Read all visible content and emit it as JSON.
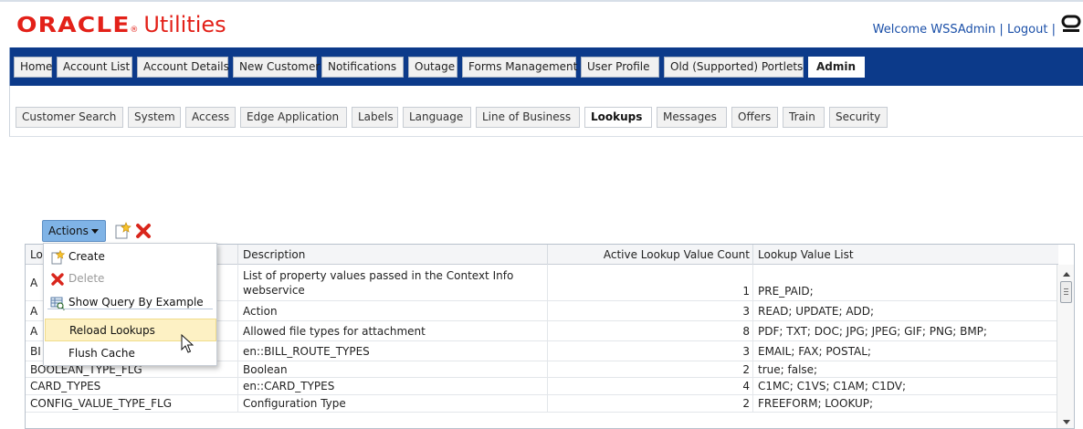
{
  "brand": {
    "oracle": "ORACLE",
    "registered": "®",
    "product": "Utilities"
  },
  "user": {
    "welcome": "Welcome WSSAdmin",
    "separator": "|",
    "logout": "Logout"
  },
  "main_tabs": [
    {
      "label": "Home",
      "active": false
    },
    {
      "label": "Account List",
      "active": false
    },
    {
      "label": "Account Details",
      "active": false
    },
    {
      "label": "New Customer",
      "active": false
    },
    {
      "label": "Notifications",
      "active": false
    },
    {
      "label": "Outage",
      "active": false
    },
    {
      "label": "Forms Management",
      "active": false
    },
    {
      "label": "User Profile",
      "active": false
    },
    {
      "label": "Old (Supported) Portlets",
      "active": false
    },
    {
      "label": "Admin",
      "active": true
    }
  ],
  "sub_tabs": [
    {
      "label": "Customer Search",
      "active": false
    },
    {
      "label": "System",
      "active": false
    },
    {
      "label": "Access",
      "active": false
    },
    {
      "label": "Edge Application",
      "active": false
    },
    {
      "label": "Labels",
      "active": false
    },
    {
      "label": "Language",
      "active": false
    },
    {
      "label": "Line of Business",
      "active": false
    },
    {
      "label": "Lookups",
      "active": true
    },
    {
      "label": "Messages",
      "active": false
    },
    {
      "label": "Offers",
      "active": false
    },
    {
      "label": "Train",
      "active": false
    },
    {
      "label": "Security",
      "active": false
    }
  ],
  "toolbar": {
    "actions_label": "Actions",
    "create_icon": "create-icon",
    "delete_icon": "delete-icon"
  },
  "actions_menu": {
    "items": [
      {
        "label": "Create",
        "icon": "create-icon",
        "disabled": false
      },
      {
        "label": "Delete",
        "icon": "delete-icon",
        "disabled": true
      },
      {
        "label": "Show Query By Example",
        "icon": "query-by-example-icon",
        "disabled": false
      },
      {
        "label": "Reload Lookups",
        "icon": "",
        "disabled": false,
        "highlighted": true
      },
      {
        "label": "Flush Cache",
        "icon": "",
        "disabled": false
      }
    ]
  },
  "table": {
    "columns": [
      "Lo",
      "Description",
      "Active Lookup Value Count",
      "Lookup Value List"
    ],
    "rows": [
      {
        "code": "A",
        "description": "List of property values passed in the Context Info webservice",
        "count": "1",
        "values": "PRE_PAID;"
      },
      {
        "code": "A",
        "description": "Action",
        "count": "3",
        "values": "READ; UPDATE; ADD;"
      },
      {
        "code": "A",
        "description": "Allowed file types for attachment",
        "count": "8",
        "values": "PDF; TXT; DOC; JPG; JPEG; GIF; PNG; BMP;"
      },
      {
        "code": "BI",
        "description": "en::BILL_ROUTE_TYPES",
        "count": "3",
        "values": "EMAIL; FAX; POSTAL;"
      },
      {
        "code": "BOOLEAN_TYPE_FLG",
        "description": "Boolean",
        "count": "2",
        "values": "true; false;"
      },
      {
        "code": "CARD_TYPES",
        "description": "en::CARD_TYPES",
        "count": "4",
        "values": "C1MC; C1VS; C1AM; C1DV;"
      },
      {
        "code": "CONFIG_VALUE_TYPE_FLG",
        "description": "Configuration Type",
        "count": "2",
        "values": "FREEFORM; LOOKUP;"
      }
    ]
  },
  "colors": {
    "brand_red": "#e32119",
    "nav_blue": "#0c3a8a",
    "link_blue": "#1a4fa8",
    "actions_button": "#7fb3e6",
    "menu_highlight": "#fdf1c4"
  }
}
